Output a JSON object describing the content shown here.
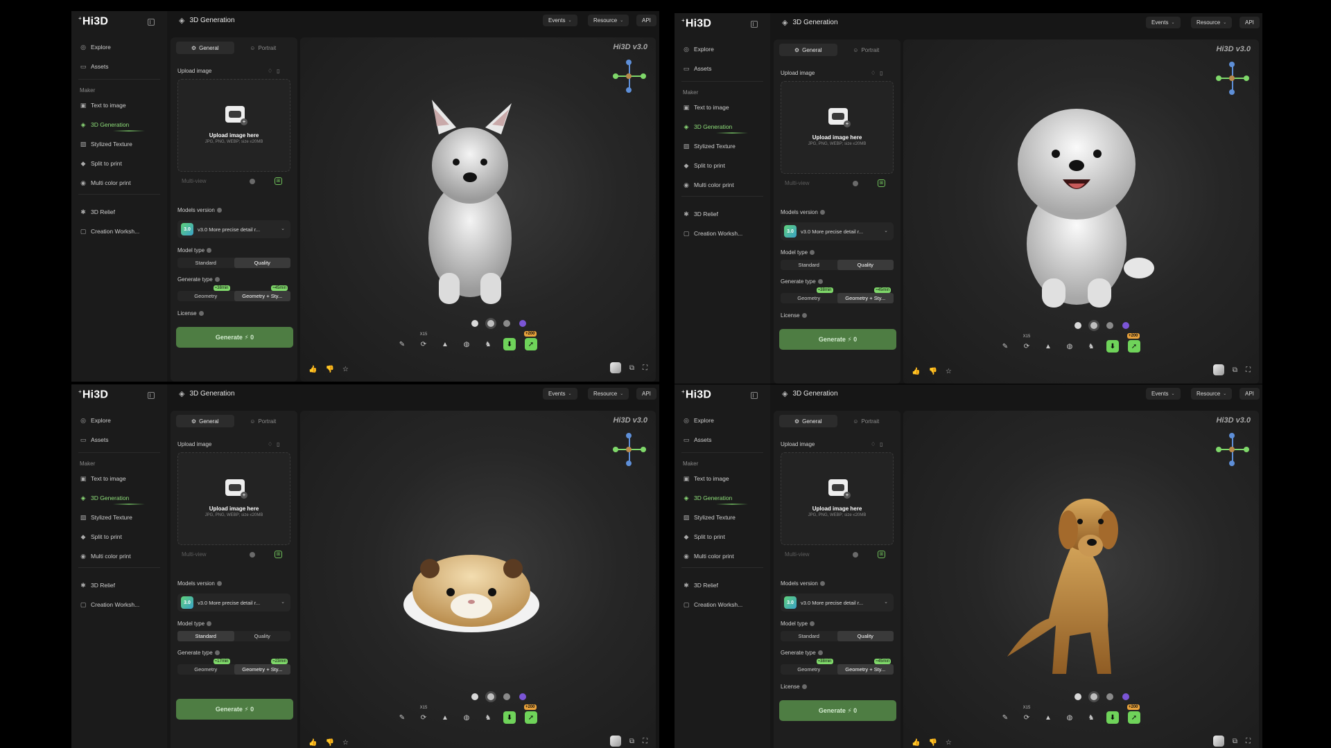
{
  "app": {
    "logo": "Hi3D",
    "title": "3D Generation",
    "brand_watermark": "Hi3D v3.0",
    "top_buttons": [
      "Events",
      "Resource",
      "API"
    ]
  },
  "sidebar": {
    "top_items": [
      {
        "label": "Explore",
        "icon": "compass-icon"
      },
      {
        "label": "Assets",
        "icon": "folder-icon"
      }
    ],
    "section_label": "Maker",
    "maker_items": [
      {
        "label": "Text to image",
        "icon": "image-icon"
      },
      {
        "label": "3D Generation",
        "icon": "cube-icon",
        "active": true
      },
      {
        "label": "Stylized Texture",
        "icon": "texture-icon"
      },
      {
        "label": "Split to print",
        "icon": "split-icon"
      },
      {
        "label": "Multi color print",
        "icon": "palette-icon"
      }
    ],
    "bottom_items": [
      {
        "label": "3D Relief",
        "icon": "relief-icon"
      },
      {
        "label": "Creation Worksh...",
        "icon": "workshop-icon"
      }
    ]
  },
  "panel": {
    "tabs": [
      "General",
      "Portrait"
    ],
    "upload_label": "Upload image",
    "upload_title": "Upload image here",
    "upload_sub": "JPG, PNG, WEBP; size ≤20MB",
    "multiview_label": "Multi-view",
    "models_version_label": "Models version",
    "model_badge": "3.0",
    "model_text": "v3.0 More precise detail r...",
    "model_type_label": "Model type",
    "model_type_options": [
      "Standard",
      "Quality"
    ],
    "generate_type_label": "Generate type",
    "generate_type_options": [
      "Geometry",
      "Geometry + Sty..."
    ],
    "license_label": "License",
    "generate_button": "Generate ⚡ 0"
  },
  "viewer": {
    "toolbar_x15": "X15",
    "toolbar_plus200": "+200",
    "material_colors": [
      "#d9d9d9",
      "#bfbfbf",
      "#8a8a8a",
      "#7b55d6"
    ]
  },
  "windows": [
    {
      "subject": "westie-dog",
      "model_type_active": "Quality",
      "generate_time_badges": [
        "≈38min",
        "≈45min"
      ],
      "generate_active": "Geometry + Sty...",
      "show_license": true
    },
    {
      "subject": "bichon-dog",
      "model_type_active": "Quality",
      "generate_time_badges": [
        "≈38min",
        "≈45min"
      ],
      "generate_active": "Geometry + Sty...",
      "show_license": true
    },
    {
      "subject": "hamster",
      "model_type_active": "Standard",
      "generate_time_badges": [
        "≈17min",
        "≈23min"
      ],
      "generate_active": "Geometry + Sty...",
      "show_license": false
    },
    {
      "subject": "golden-retriever",
      "model_type_active": "Quality",
      "generate_time_badges": [
        "≈38min",
        "≈45min"
      ],
      "generate_active": "Geometry + Sty...",
      "show_license": true
    }
  ]
}
